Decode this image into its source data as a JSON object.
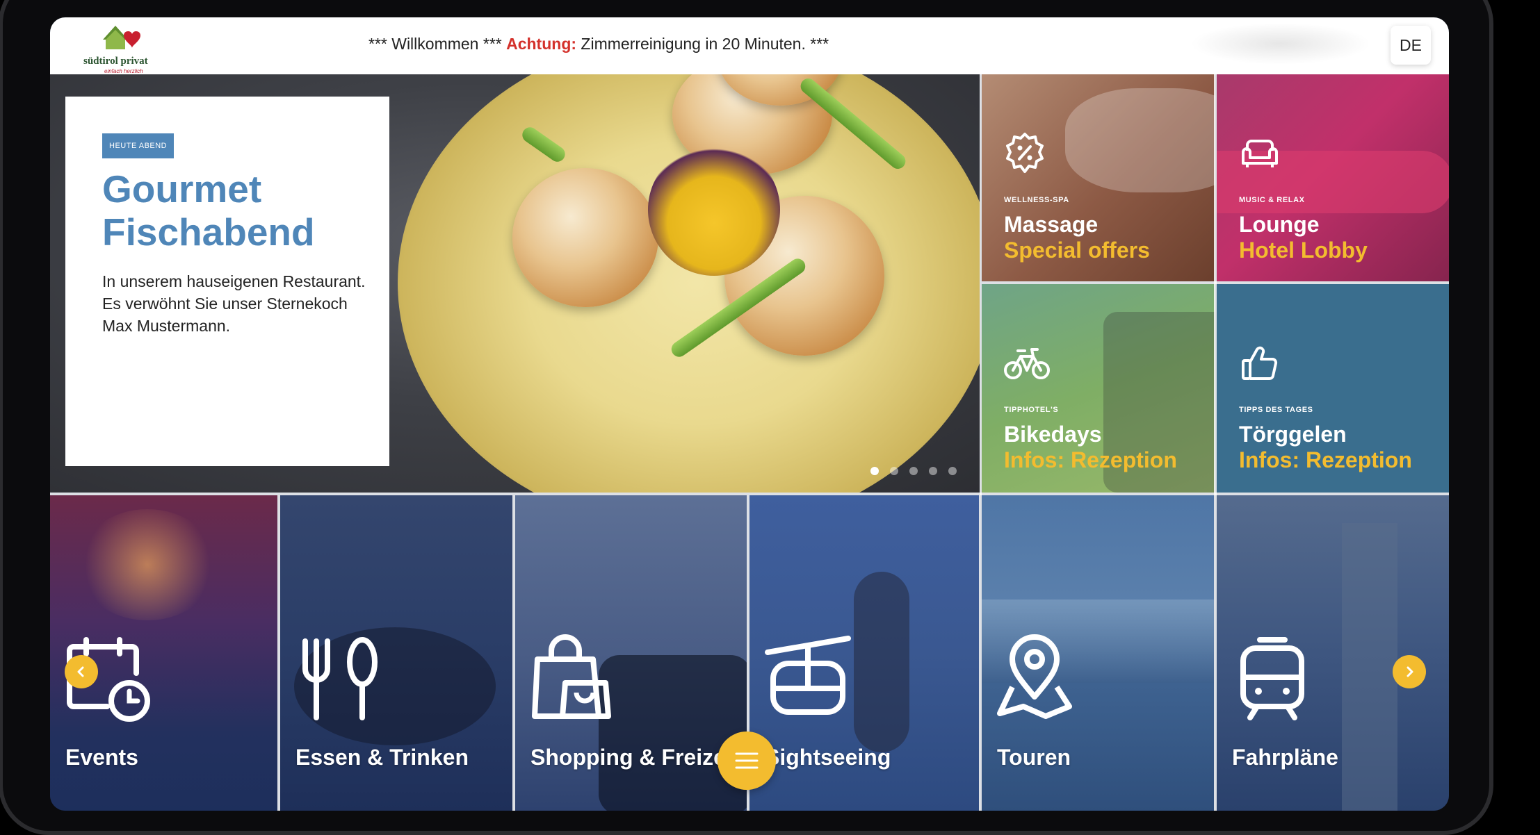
{
  "header": {
    "logo_text": "südtirol privat",
    "logo_sub": "einfach herzlich",
    "ticker_prefix": "*** Willkommen ***",
    "ticker_warning": "Achtung:",
    "ticker_message": "Zimmerreinigung in 20 Minuten. ***",
    "language": "DE"
  },
  "hero": {
    "tag": "HEUTE ABEND",
    "title_line1": "Gourmet",
    "title_line2": "Fischabend",
    "text": "In unserem hauseigenen Restaurant. Es verwöhnt Sie unser Sternekoch Max Mustermann.",
    "slides_total": 5,
    "slide_active": 1
  },
  "tiles": [
    {
      "icon": "percent-badge-icon",
      "sub": "WELLNESS-SPA",
      "title": "Massage",
      "highlight": "Special offers"
    },
    {
      "icon": "sofa-icon",
      "sub": "MUSIC & RELAX",
      "title": "Lounge",
      "highlight": "Hotel Lobby"
    },
    {
      "icon": "bicycle-icon",
      "sub": "TIPPHOTEL'S",
      "title": "Bikedays",
      "highlight": "Infos: Rezeption"
    },
    {
      "icon": "thumbs-up-icon",
      "sub": "TIPPS DES TAGES",
      "title": "Törggelen",
      "highlight": "Infos: Rezeption"
    }
  ],
  "categories": [
    {
      "icon": "calendar-clock-icon",
      "label": "Events"
    },
    {
      "icon": "fork-spoon-icon",
      "label": "Essen & Trinken"
    },
    {
      "icon": "shopping-bag-icon",
      "label": "Shopping & Freizeit"
    },
    {
      "icon": "cable-car-icon",
      "label": "Sightseeing"
    },
    {
      "icon": "map-pin-icon",
      "label": "Touren"
    },
    {
      "icon": "train-icon",
      "label": "Fahrpläne"
    }
  ],
  "colors": {
    "accent_yellow": "#f3bc2f",
    "brand_blue": "#4f86b8",
    "warning_red": "#d4312b",
    "category_overlay": "#1d3666"
  }
}
